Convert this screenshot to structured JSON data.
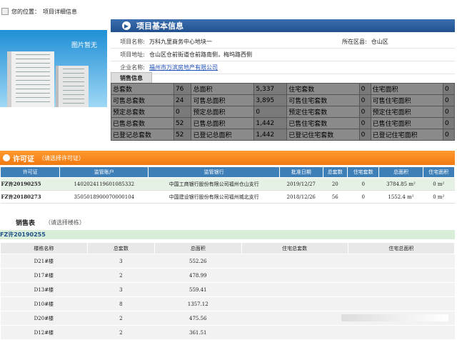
{
  "breadcrumb": {
    "prefix": "您的位置：",
    "current": "项目详细信息"
  },
  "photo": {
    "caption": "图片暂无"
  },
  "section_basic": {
    "title": "项目基本信息"
  },
  "project": {
    "name_label": "项目名称:",
    "name": "万科九里商务中心地块一",
    "district_label": "所在区县:",
    "district": "仓山区",
    "address_label": "项目地址:",
    "address": "仓山区仓前街道仓前路南侧，梅坞路西侧",
    "company_label": "企业名称:",
    "company": "福州市万滨房地产有限公司"
  },
  "sales_tab": "销售信息",
  "sales_grid": [
    [
      "总套数",
      "76",
      "总面积",
      "5,337",
      "住宅套数",
      "0",
      "住宅面积",
      "0"
    ],
    [
      "可售总套数",
      "24",
      "可售总面积",
      "3,895",
      "可售住宅套数",
      "0",
      "可售住宅面积",
      "0"
    ],
    [
      "预定总套数",
      "0",
      "预定总面积",
      "0",
      "预定住宅套数",
      "0",
      "预定住宅面积",
      "0"
    ],
    [
      "已售总套数",
      "52",
      "已售总面积",
      "1,442",
      "已售住宅套数",
      "0",
      "已售住宅面积",
      "0"
    ],
    [
      "已登记总套数",
      "52",
      "已登记总面积",
      "1,442",
      "已登记住宅套数",
      "0",
      "已登记住宅面积",
      "0"
    ]
  ],
  "license": {
    "title": "许可证",
    "hint": "（请选择许可证）",
    "columns": [
      "许可证",
      "监管账户",
      "监管银行",
      "批准日期",
      "总套数",
      "住宅套数",
      "总面积",
      "住宅面积"
    ],
    "rows": [
      [
        "FZ许20190255",
        "1402024119601085332",
        "中国工商银行股份有限公司福州仓山支行",
        "2019/12/27",
        "20",
        "0",
        "3784.85 m²",
        "0 m²"
      ],
      [
        "FZ许20180273",
        "3505018900070000104",
        "中国建设银行股份有限公司福州城北支行",
        "2018/12/26",
        "56",
        "0",
        "1552.4 m²",
        "0 m²"
      ]
    ]
  },
  "sales_table": {
    "title": "销售表",
    "hint": "（请选择楼栋）",
    "permit": "FZ许20190255",
    "columns": [
      "楼栋名称",
      "总套数",
      "总面积",
      "住宅总套数",
      "住宅总面积"
    ],
    "rows": [
      [
        "D21#楼",
        "3",
        "552.26",
        "",
        ""
      ],
      [
        "D17#楼",
        "2",
        "478.99",
        "",
        ""
      ],
      [
        "D13#楼",
        "3",
        "559.41",
        "",
        ""
      ],
      [
        "D10#楼",
        "8",
        "1357.12",
        "",
        ""
      ],
      [
        "D20#楼",
        "2",
        "475.56",
        "",
        ""
      ],
      [
        "D12#楼",
        "2",
        "361.51",
        "",
        ""
      ]
    ]
  }
}
